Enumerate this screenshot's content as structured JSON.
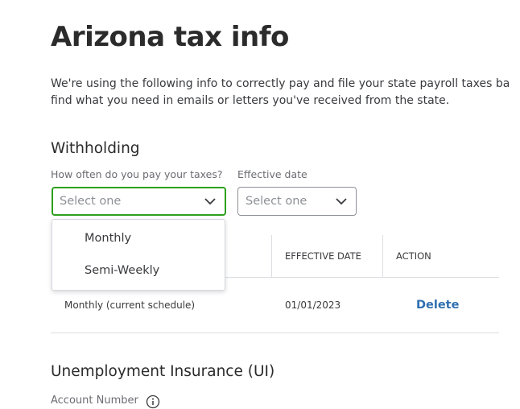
{
  "page": {
    "title": "Arizona tax info",
    "intro_line1": "We're using the following info to correctly pay and file your state payroll taxes ba",
    "intro_line2": "find what you need in emails or letters you've received from the state."
  },
  "withholding": {
    "heading": "Withholding",
    "frequency_label": "How often do you pay your taxes?",
    "frequency_placeholder": "Select one",
    "effective_label": "Effective date",
    "effective_placeholder": "Select one",
    "dropdown_options": [
      "Monthly",
      "Semi-Weekly"
    ],
    "table": {
      "col_effective": "EFFECTIVE DATE",
      "col_action": "ACTION",
      "rows": [
        {
          "schedule": "Monthly (current schedule)",
          "effective": "01/01/2023",
          "action": "Delete"
        }
      ]
    }
  },
  "ui": {
    "heading": "Unemployment Insurance (UI)",
    "account_label": "Account Number"
  },
  "icons": {
    "select_chevron": "chevron-down-icon",
    "account_info": "info-icon"
  },
  "colors": {
    "focus_border": "#2ca01c",
    "link": "#2f6fb0"
  }
}
